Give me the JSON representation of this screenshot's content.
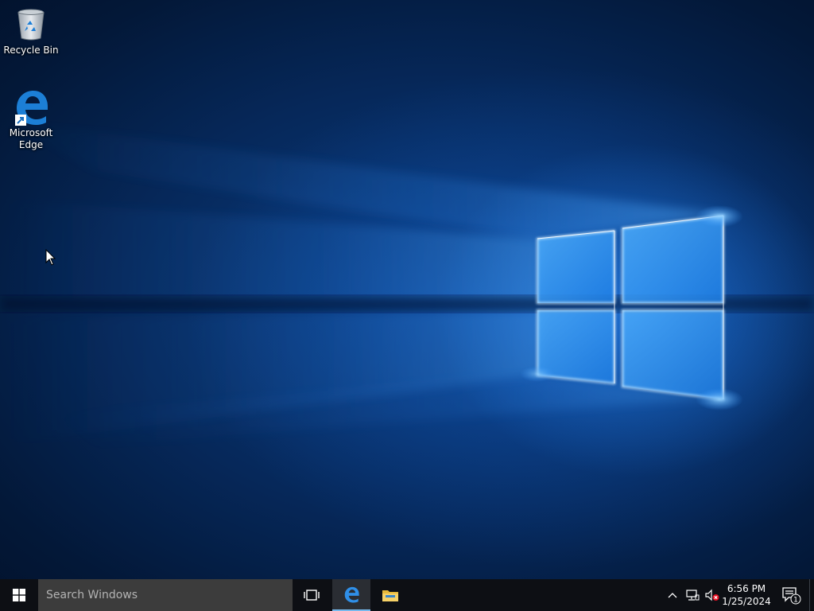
{
  "desktop": {
    "icons": [
      {
        "label": "Recycle Bin",
        "icon": "recycle-bin-icon"
      },
      {
        "label": "Microsoft Edge",
        "icon": "edge-icon"
      }
    ]
  },
  "taskbar": {
    "start_icon": "windows-logo-icon",
    "search_placeholder": "Search Windows",
    "apps": [
      {
        "name": "Task View",
        "icon": "task-view-icon"
      },
      {
        "name": "Microsoft Edge",
        "icon": "edge-icon",
        "active": true
      },
      {
        "name": "File Explorer",
        "icon": "folder-icon"
      }
    ],
    "tray": {
      "icons": [
        "chevron-up-icon",
        "network-icon",
        "volume-muted-icon"
      ],
      "time": "6:56 PM",
      "date": "1/25/2024",
      "notification_count": "1"
    }
  },
  "colors": {
    "taskbar_bg": "#0d0f14",
    "search_bg": "#3c3c3c",
    "accent": "#76b9ed",
    "wallpaper_glow": "#3a9bff"
  }
}
